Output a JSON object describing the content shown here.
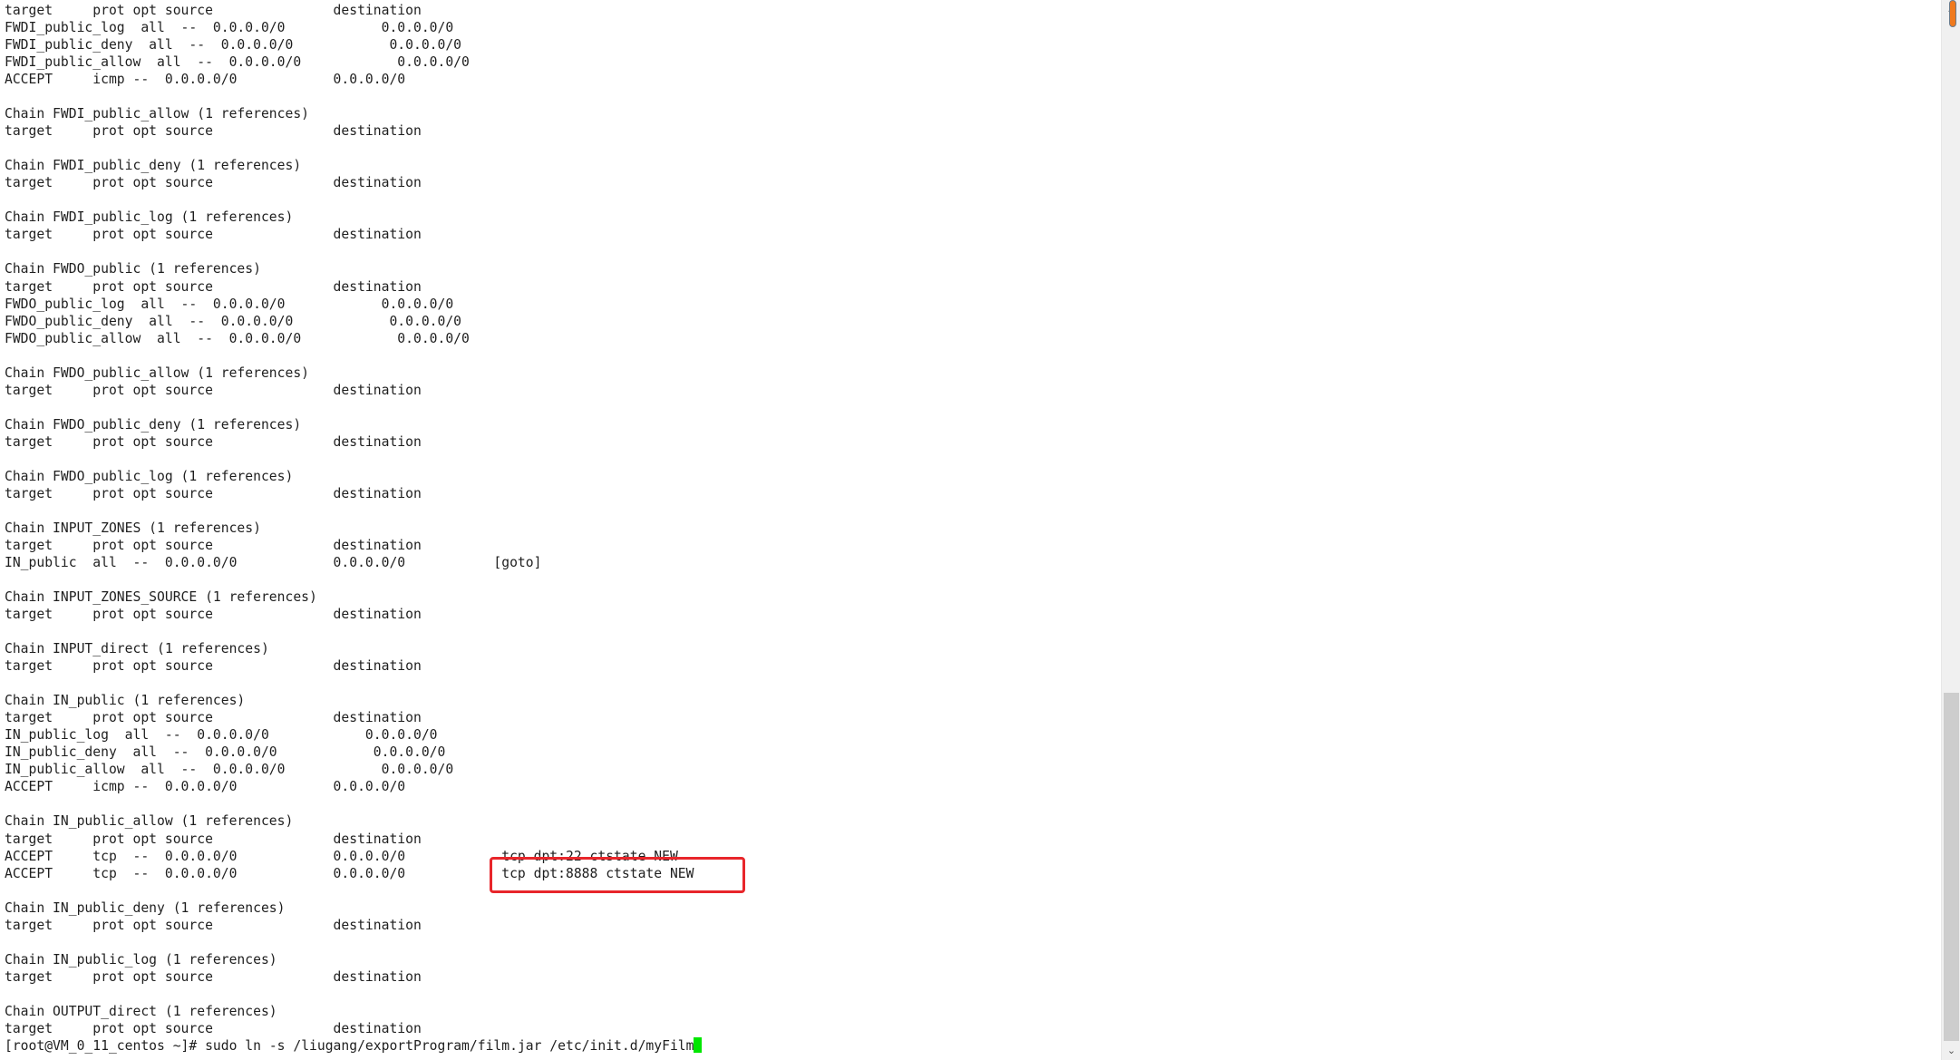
{
  "terminal": {
    "lines": [
      "target     prot opt source               destination",
      "FWDI_public_log  all  --  0.0.0.0/0            0.0.0.0/0",
      "FWDI_public_deny  all  --  0.0.0.0/0            0.0.0.0/0",
      "FWDI_public_allow  all  --  0.0.0.0/0            0.0.0.0/0",
      "ACCEPT     icmp --  0.0.0.0/0            0.0.0.0/0",
      "",
      "Chain FWDI_public_allow (1 references)",
      "target     prot opt source               destination",
      "",
      "Chain FWDI_public_deny (1 references)",
      "target     prot opt source               destination",
      "",
      "Chain FWDI_public_log (1 references)",
      "target     prot opt source               destination",
      "",
      "Chain FWDO_public (1 references)",
      "target     prot opt source               destination",
      "FWDO_public_log  all  --  0.0.0.0/0            0.0.0.0/0",
      "FWDO_public_deny  all  --  0.0.0.0/0            0.0.0.0/0",
      "FWDO_public_allow  all  --  0.0.0.0/0            0.0.0.0/0",
      "",
      "Chain FWDO_public_allow (1 references)",
      "target     prot opt source               destination",
      "",
      "Chain FWDO_public_deny (1 references)",
      "target     prot opt source               destination",
      "",
      "Chain FWDO_public_log (1 references)",
      "target     prot opt source               destination",
      "",
      "Chain INPUT_ZONES (1 references)",
      "target     prot opt source               destination",
      "IN_public  all  --  0.0.0.0/0            0.0.0.0/0           [goto]",
      "",
      "Chain INPUT_ZONES_SOURCE (1 references)",
      "target     prot opt source               destination",
      "",
      "Chain INPUT_direct (1 references)",
      "target     prot opt source               destination",
      "",
      "Chain IN_public (1 references)",
      "target     prot opt source               destination",
      "IN_public_log  all  --  0.0.0.0/0            0.0.0.0/0",
      "IN_public_deny  all  --  0.0.0.0/0            0.0.0.0/0",
      "IN_public_allow  all  --  0.0.0.0/0            0.0.0.0/0",
      "ACCEPT     icmp --  0.0.0.0/0            0.0.0.0/0",
      "",
      "Chain IN_public_allow (1 references)",
      "target     prot opt source               destination",
      "ACCEPT     tcp  --  0.0.0.0/0            0.0.0.0/0            tcp dpt:22 ctstate NEW",
      "ACCEPT     tcp  --  0.0.0.0/0            0.0.0.0/0            tcp dpt:8888 ctstate NEW",
      "",
      "Chain IN_public_deny (1 references)",
      "target     prot opt source               destination",
      "",
      "Chain IN_public_log (1 references)",
      "target     prot opt source               destination",
      "",
      "Chain OUTPUT_direct (1 references)",
      "target     prot opt source               destination"
    ],
    "prompt": "[root@VM_0_11_centos ~]# ",
    "command": "sudo ln -s /liugang/exportProgram/film.jar /etc/init.d/myFilm",
    "cursor_color": "#00e600",
    "highlight_color": "#e8262b",
    "highlighted_text": "tcp dpt:8888 ctstate NEW"
  },
  "scrollbar": {
    "up_icon": "▴",
    "down_icon": "⌄"
  }
}
